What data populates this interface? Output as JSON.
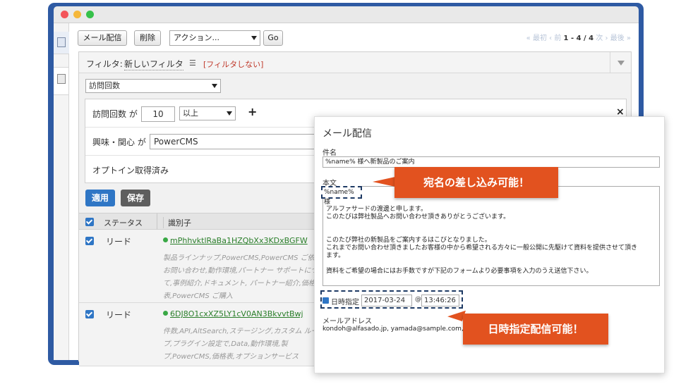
{
  "toolbar": {
    "mail_label": "メール配信",
    "delete_label": "削除",
    "action_value": "アクション...",
    "go_label": "Go"
  },
  "pager": {
    "first": "« 最初",
    "prev": "‹ 前",
    "range": "1 - 4 / 4",
    "next": "次 ›",
    "last": "最後 »"
  },
  "filter": {
    "label": "フィルタ:",
    "name": "新しいフィルタ",
    "list_icon": "list-icon",
    "no_filter": "[フィルタしない]",
    "field_select": "訪問回数",
    "conditions": {
      "visits_label": "訪問回数 が",
      "visits_value": "10",
      "visits_op": "以上",
      "interest_label": "興味・関心 が",
      "interest_value": "PowerCMS",
      "optin_label": "オプトイン取得済み"
    },
    "apply_label": "適用",
    "save_label": "保存"
  },
  "table": {
    "columns": [
      "ステータス",
      "識別子"
    ],
    "rows": [
      {
        "status": "リード",
        "id": "mPhhvktlRaBa1HZQbXx3KDxBGFW",
        "desc": "製品ラインナップ,PowerCMS,PowerCMS ご依頼,お問い合わせ,動作環境,パートナー サポートについて,事例紹介,ドキュメント, パートナー紹介,価格表,PowerCMS ご購入"
      },
      {
        "status": "リード",
        "id": "6DJ8O1cxXZ5LY1cV0AN3BkvvtBwj",
        "desc": "件数,API,AltSearch,ステージング,カスタム ループ,プラグイン設定で,Data,動作環境,製 プ,PowerCMS,価格表,オプションサービス"
      }
    ]
  },
  "dialog": {
    "title": "メール配信",
    "subject_label": "件名",
    "subject_value": "%name% 様へ新製品のご案内",
    "body_label": "本文",
    "name_tag": "%name% 様",
    "body_lines_1": [
      "アルファサードの渡邊と申します。",
      "このたびは弊社製品へお問い合わせ頂きありがとうございます。"
    ],
    "body_lines_2": [
      "このたび弊社の新製品をご案内するはこびとなりました。",
      "これまでお問い合わせ頂きましたお客様の中から希望される方々に一般公開に先駆けて資料を提供させて頂き",
      "ます。"
    ],
    "body_lines_3": [
      "資料をご希望の場合にはお手数ですが下記のフォームより必要事項を入力のうえ送信下さい。"
    ],
    "schedule_label": "日時指定",
    "schedule_date": "2017-03-24",
    "at": "@",
    "schedule_time": "13:46:26",
    "email_label": "メールアドレス",
    "email_value": "kondoh@alfasado.jp, yamada@sample.com, w"
  },
  "callouts": {
    "merge": "宛名の差し込み可能！",
    "schedule": "日時指定配信可能！"
  },
  "colors": {
    "window_frame": "#2e5aa3",
    "callout": "#e2521f",
    "primary_button": "#2f76c5",
    "secondary_button": "#5e5e5e",
    "link_green": "#2a7e2a"
  }
}
